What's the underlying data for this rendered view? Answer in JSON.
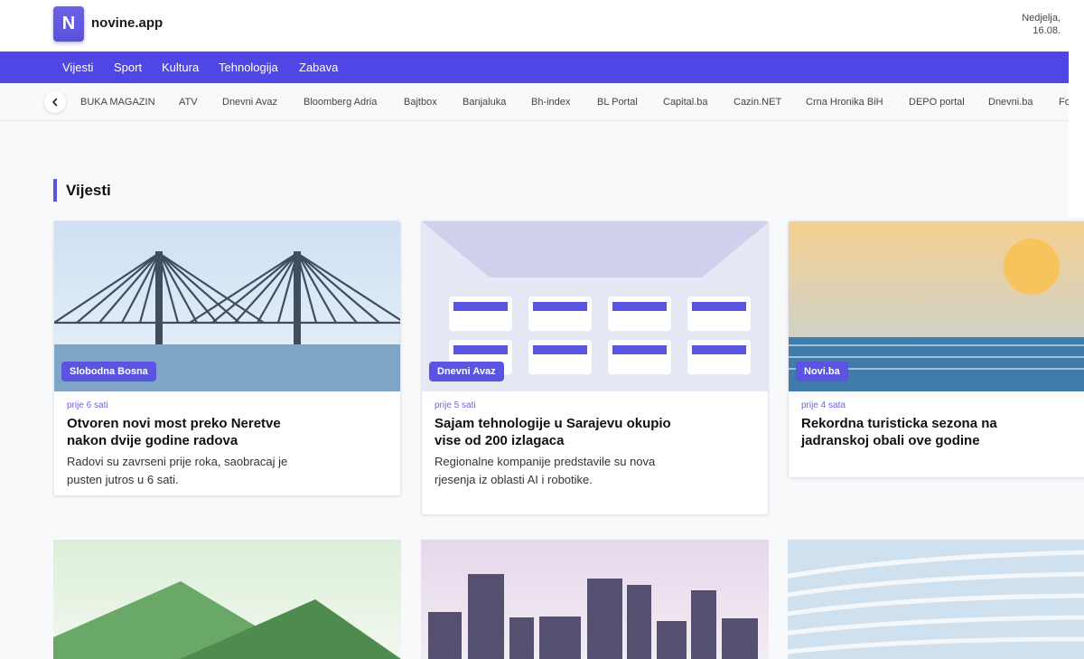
{
  "header": {
    "logo_letter": "N",
    "brand": "novine.app",
    "date_line1": "Nedjelja,",
    "date_line2": "16.08."
  },
  "nav": [
    "Vijesti",
    "Sport",
    "Kultura",
    "Tehnologija",
    "Zabava"
  ],
  "sources": [
    "BUKA MAGAZIN",
    "ATV",
    "Dnevni Avaz",
    "Bloomberg Adria",
    "Bajtbox",
    "Banjaluka",
    "Bh-index",
    "BL Portal",
    "Capital.ba",
    "Cazin.NET",
    "Crna Hronika BiH",
    "DEPO portal",
    "Dnevni.ba",
    "Fo"
  ],
  "section": {
    "title": "Vijesti"
  },
  "articles": [
    {
      "source": "Slobodna Bosna",
      "time": "prije 6 sati",
      "title": "Otvoren novi most preko Neretve nakon dvije godine radova",
      "description": "Radovi su zavrseni prije roka, saobracaj je pusten jutros u 6 sati."
    },
    {
      "source": "Dnevni Avaz",
      "time": "prije 5 sati",
      "title": "Sajam tehnologije u Sarajevu okupio vise od 200 izlagaca",
      "description": "Regionalne kompanije predstavile su nova rjesenja iz oblasti AI i robotike."
    },
    {
      "source": "Novi.ba",
      "time": "prije 4 sata",
      "title": "Rekordna turisticka sezona na jadranskoj obali ove godine",
      "description": ""
    }
  ],
  "colors": {
    "accent": "#4f46e5",
    "badge": "#5b54e0"
  }
}
